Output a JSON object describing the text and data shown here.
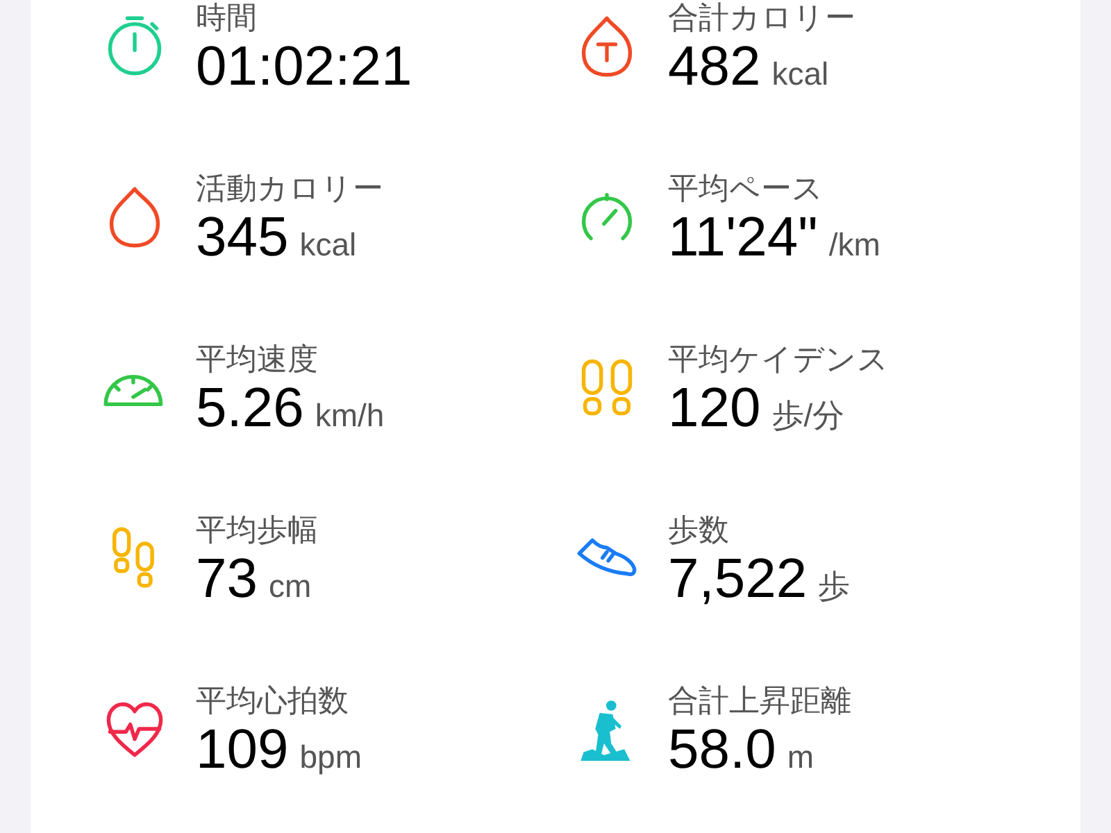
{
  "metrics": [
    {
      "label": "時間",
      "value": "01:02:21"
    },
    {
      "label": "合計カロリー",
      "value": "482",
      "unit": "kcal"
    },
    {
      "label": "活動カロリー",
      "value": "345",
      "unit": "kcal"
    },
    {
      "label": "平均ペース",
      "value": "11'24\"",
      "unit": "/km"
    },
    {
      "label": "平均速度",
      "value": "5.26",
      "unit": "km/h"
    },
    {
      "label": "平均ケイデンス",
      "value": "120",
      "unit": "歩/分"
    },
    {
      "label": "平均歩幅",
      "value": "73",
      "unit": "cm"
    },
    {
      "label": "歩数",
      "value": "7,522",
      "unit": "歩"
    },
    {
      "label": "平均心拍数",
      "value": "109",
      "unit": "bpm"
    },
    {
      "label": "合計上昇距離",
      "value": "58.0",
      "unit": "m"
    }
  ]
}
